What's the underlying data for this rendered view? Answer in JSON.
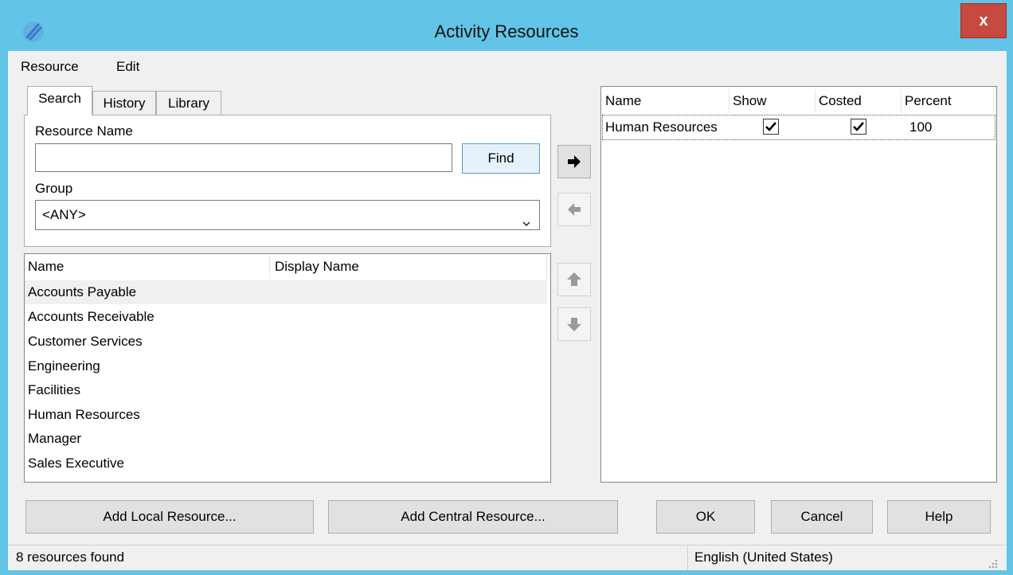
{
  "window": {
    "title": "Activity Resources",
    "close_label": "x"
  },
  "menu": {
    "items": [
      "Resource",
      "Edit"
    ]
  },
  "tabs": [
    "Search",
    "History",
    "Library"
  ],
  "search": {
    "resource_name_label": "Resource Name",
    "resource_name_value": "",
    "find_label": "Find",
    "group_label": "Group",
    "group_value": "<ANY>"
  },
  "results": {
    "columns": [
      "Name",
      "Display Name"
    ],
    "rows": [
      "Accounts Payable",
      "Accounts Receivable",
      "Customer Services",
      "Engineering",
      "Facilities",
      "Human Resources",
      "Manager",
      "Sales Executive"
    ]
  },
  "assigned": {
    "columns": [
      "Name",
      "Show",
      "Costed",
      "Percent"
    ],
    "rows": [
      {
        "name": "Human Resources",
        "show": true,
        "costed": true,
        "percent": "100"
      }
    ]
  },
  "buttons": {
    "add_local": "Add Local Resource...",
    "add_central": "Add Central Resource...",
    "ok": "OK",
    "cancel": "Cancel",
    "help": "Help"
  },
  "status": {
    "left": "8 resources found",
    "right": "English (United States)"
  }
}
